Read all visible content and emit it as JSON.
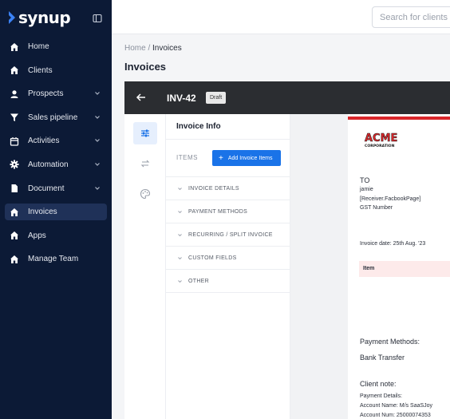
{
  "app": {
    "logo_text": "synup",
    "brand_color": "#2563eb",
    "accent_color": "#1a73e8",
    "sidebar_bg": "#0c1a36"
  },
  "sidebar": {
    "items": [
      {
        "label": "Home",
        "icon": "home-icon",
        "has_chevron": false
      },
      {
        "label": "Clients",
        "icon": "home-icon",
        "has_chevron": false
      },
      {
        "label": "Prospects",
        "icon": "user-icon",
        "has_chevron": true
      },
      {
        "label": "Sales pipeline",
        "icon": "funnel-icon",
        "has_chevron": true
      },
      {
        "label": "Activities",
        "icon": "calendar-icon",
        "has_chevron": true
      },
      {
        "label": "Automation",
        "icon": "gear-icon",
        "has_chevron": true
      },
      {
        "label": "Document",
        "icon": "document-icon",
        "has_chevron": true
      },
      {
        "label": "Invoices",
        "icon": "home-icon",
        "has_chevron": false,
        "active": true
      },
      {
        "label": "Apps",
        "icon": "home-icon",
        "has_chevron": false
      },
      {
        "label": "Manage Team",
        "icon": "home-icon",
        "has_chevron": false
      }
    ]
  },
  "header": {
    "search_placeholder": "Search for clients"
  },
  "breadcrumb": {
    "root": "Home",
    "separator": " / ",
    "current": "Invoices"
  },
  "page": {
    "title": "Invoices"
  },
  "invoice": {
    "number": "INV-42",
    "status": "Draft"
  },
  "info_panel": {
    "title": "Invoice Info",
    "items_label": "ITEMS",
    "add_button": "Add Invoice Items",
    "sections": [
      "INVOICE DETAILS",
      "PAYMENT METHODS",
      "RECURRING / SPLIT INVOICE",
      "CUSTOM FIELDS",
      "OTHER"
    ]
  },
  "preview": {
    "to_label": "TO",
    "receiver_name": "jamie",
    "receiver_page": "[Receiver.FacbookPage]",
    "gst": "GST Number",
    "invoice_date": "Invoice date: 25th Aug. '23",
    "item_header": "Item",
    "payment_methods_label": "Payment Methods:",
    "payment_method": "Bank Transfer",
    "client_note_label": "Client note:",
    "payment_details": "Payment Details:",
    "account_name": "Account Name: M/s SaaSJoy",
    "account_num": "Account Num: 25000074353"
  }
}
